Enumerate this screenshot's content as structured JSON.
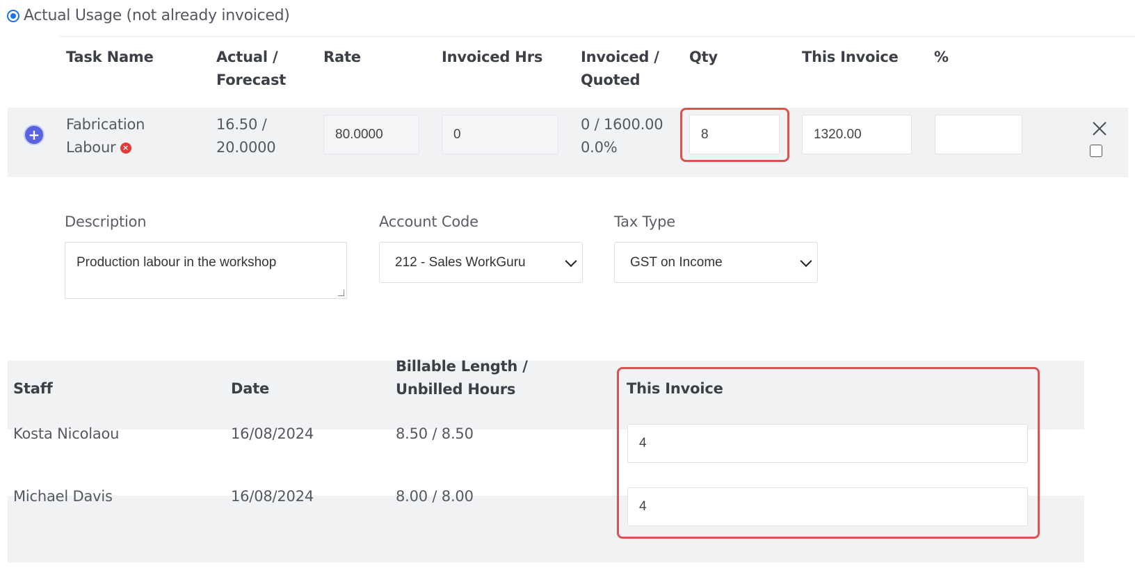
{
  "usage_option": {
    "label": "Actual Usage (not already invoiced)",
    "selected": true
  },
  "task_table": {
    "headers": {
      "task_name": "Task Name",
      "actual_forecast": [
        "Actual /",
        "Forecast"
      ],
      "rate": "Rate",
      "invoiced_hrs": "Invoiced Hrs",
      "invoiced_quoted": [
        "Invoiced /",
        "Quoted"
      ],
      "qty": "Qty",
      "this_invoice": "This Invoice",
      "percent": "%"
    },
    "row": {
      "task_name": [
        "Fabrication",
        "Labour"
      ],
      "actual_forecast": [
        "16.50 /",
        "20.0000"
      ],
      "rate": "80.0000",
      "invoiced_hrs": "0",
      "invoiced_quoted": [
        "0 / 1600.00",
        "0.0%"
      ],
      "qty": "8",
      "this_invoice": "1320.00",
      "percent": ""
    }
  },
  "details": {
    "description_label": "Description",
    "description_value": "Production labour in the workshop",
    "account_code_label": "Account Code",
    "account_code_value": "212 - Sales WorkGuru",
    "tax_type_label": "Tax Type",
    "tax_type_value": "GST on Income"
  },
  "staff_table": {
    "headers": {
      "staff": "Staff",
      "date": "Date",
      "billable": [
        "Billable Length /",
        "Unbilled Hours"
      ],
      "this_invoice": "This Invoice"
    },
    "rows": [
      {
        "staff": "Kosta Nicolaou",
        "date": "16/08/2024",
        "billable": "8.50 / 8.50",
        "this_invoice": "4"
      },
      {
        "staff": "Michael Davis",
        "date": "16/08/2024",
        "billable": "8.00 / 8.00",
        "this_invoice": "4"
      }
    ]
  },
  "colors": {
    "accent": "#1a73e8",
    "highlight": "#d9534f",
    "band": "#f1f2f4",
    "add_button": "#5863e0",
    "error": "#e53935"
  }
}
